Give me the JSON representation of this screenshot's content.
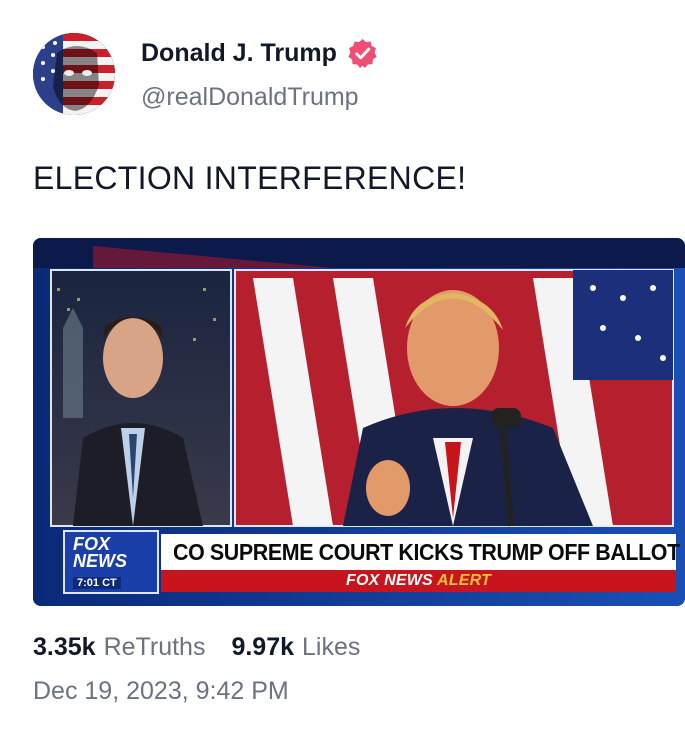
{
  "author": {
    "name": "Donald J. Trump",
    "handle": "@realDonaldTrump",
    "avatar_icon": "flag-face-avatar-icon",
    "verified_icon": "verified-badge-icon",
    "verified_color": "#ef4e75"
  },
  "post": {
    "text": "ELECTION INTERFERENCE!"
  },
  "media": {
    "network_logo_line1": "FOX",
    "network_logo_line2": "NEWS",
    "time": "7:01 CT",
    "headline": "CO SUPREME COURT KICKS TRUMP OFF BALLOT",
    "alert_brand": "FOX NEWS",
    "alert_word": "ALERT"
  },
  "stats": {
    "retruths_count": "3.35k",
    "retruths_label": "ReTruths",
    "likes_count": "9.97k",
    "likes_label": "Likes"
  },
  "timestamp": "Dec 19, 2023, 9:42 PM",
  "colors": {
    "text_primary": "#111827",
    "text_secondary": "#6b7280",
    "fox_blue": "#1a3fa8",
    "alert_red": "#c8141c"
  }
}
